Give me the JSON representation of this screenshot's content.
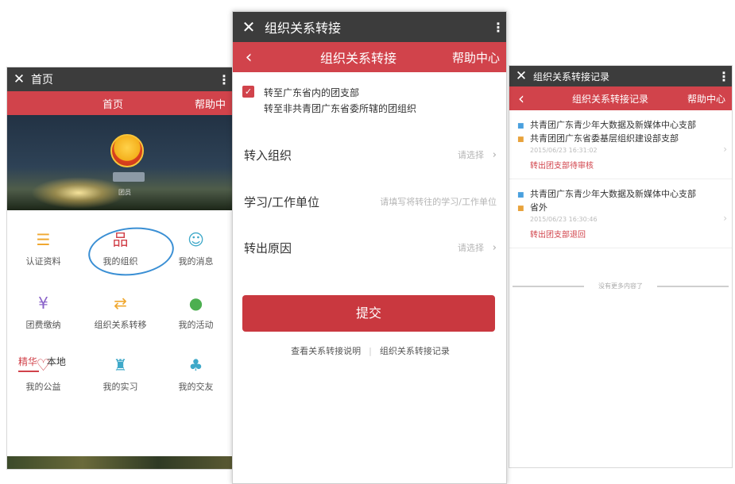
{
  "left_screen": {
    "window_title": "首页",
    "header_title": "首页",
    "help_label": "帮助中",
    "banner_org_label": "团员",
    "grid": [
      {
        "label": "认证资料",
        "icon": "certificate-icon",
        "glyph": "☰",
        "color": "#f0a830"
      },
      {
        "label": "我的组织",
        "icon": "organization-icon",
        "glyph": "品",
        "color": "#d1434b"
      },
      {
        "label": "我的消息",
        "icon": "message-icon",
        "glyph": "☺",
        "color": "#3fa9c9"
      },
      {
        "label": "团费缴纳",
        "icon": "yuan-icon",
        "glyph": "¥",
        "color": "#8a63c9"
      },
      {
        "label": "组织关系转移",
        "icon": "transfer-icon",
        "glyph": "⇄",
        "color": "#f0a830"
      },
      {
        "label": "我的活动",
        "icon": "balloon-icon",
        "glyph": "●",
        "color": "#4caf50"
      },
      {
        "label": "我的公益",
        "icon": "heart-icon",
        "glyph": "♡",
        "color": "#d1434b"
      },
      {
        "label": "我的实习",
        "icon": "internship-icon",
        "glyph": "♜",
        "color": "#3fa9c9"
      },
      {
        "label": "我的交友",
        "icon": "friends-icon",
        "glyph": "♣",
        "color": "#3fa9c9"
      }
    ],
    "tabs": [
      "精华",
      "本地"
    ]
  },
  "middle_screen": {
    "window_title": "组织关系转接",
    "header_title": "组织关系转接",
    "help_label": "帮助中心",
    "checkbox_option": "转至广东省内的团支部",
    "other_option": "转至非共青团广东省委所辖的团组织",
    "fields": [
      {
        "label": "转入组织",
        "value": "请选择",
        "has_chevron": true
      },
      {
        "label": "学习/工作单位",
        "value": "请填写将转往的学习/工作单位",
        "has_chevron": false
      },
      {
        "label": "转出原因",
        "value": "请选择",
        "has_chevron": true
      }
    ],
    "submit_label": "提交",
    "link_guide": "查看关系转接说明",
    "link_records": "组织关系转接记录"
  },
  "right_screen": {
    "window_title": "组织关系转接记录",
    "header_title": "组织关系转接记录",
    "help_label": "帮助中心",
    "records": [
      {
        "from": "共青团广东青少年大数据及新媒体中心支部",
        "to": "共青团团广东省委基层组织建设部支部",
        "time": "2015/06/23 16:31:02",
        "status": "转出团支部待审核"
      },
      {
        "from": "共青团广东青少年大数据及新媒体中心支部",
        "to": "省外",
        "time": "2015/06/23 16:30:46",
        "status": "转出团支部退回"
      }
    ],
    "no_more": "没有更多内容了"
  },
  "colors": {
    "brand_red": "#d1434b",
    "status_bar": "#3c3c3c",
    "annotation_blue": "#3a8fd4"
  }
}
